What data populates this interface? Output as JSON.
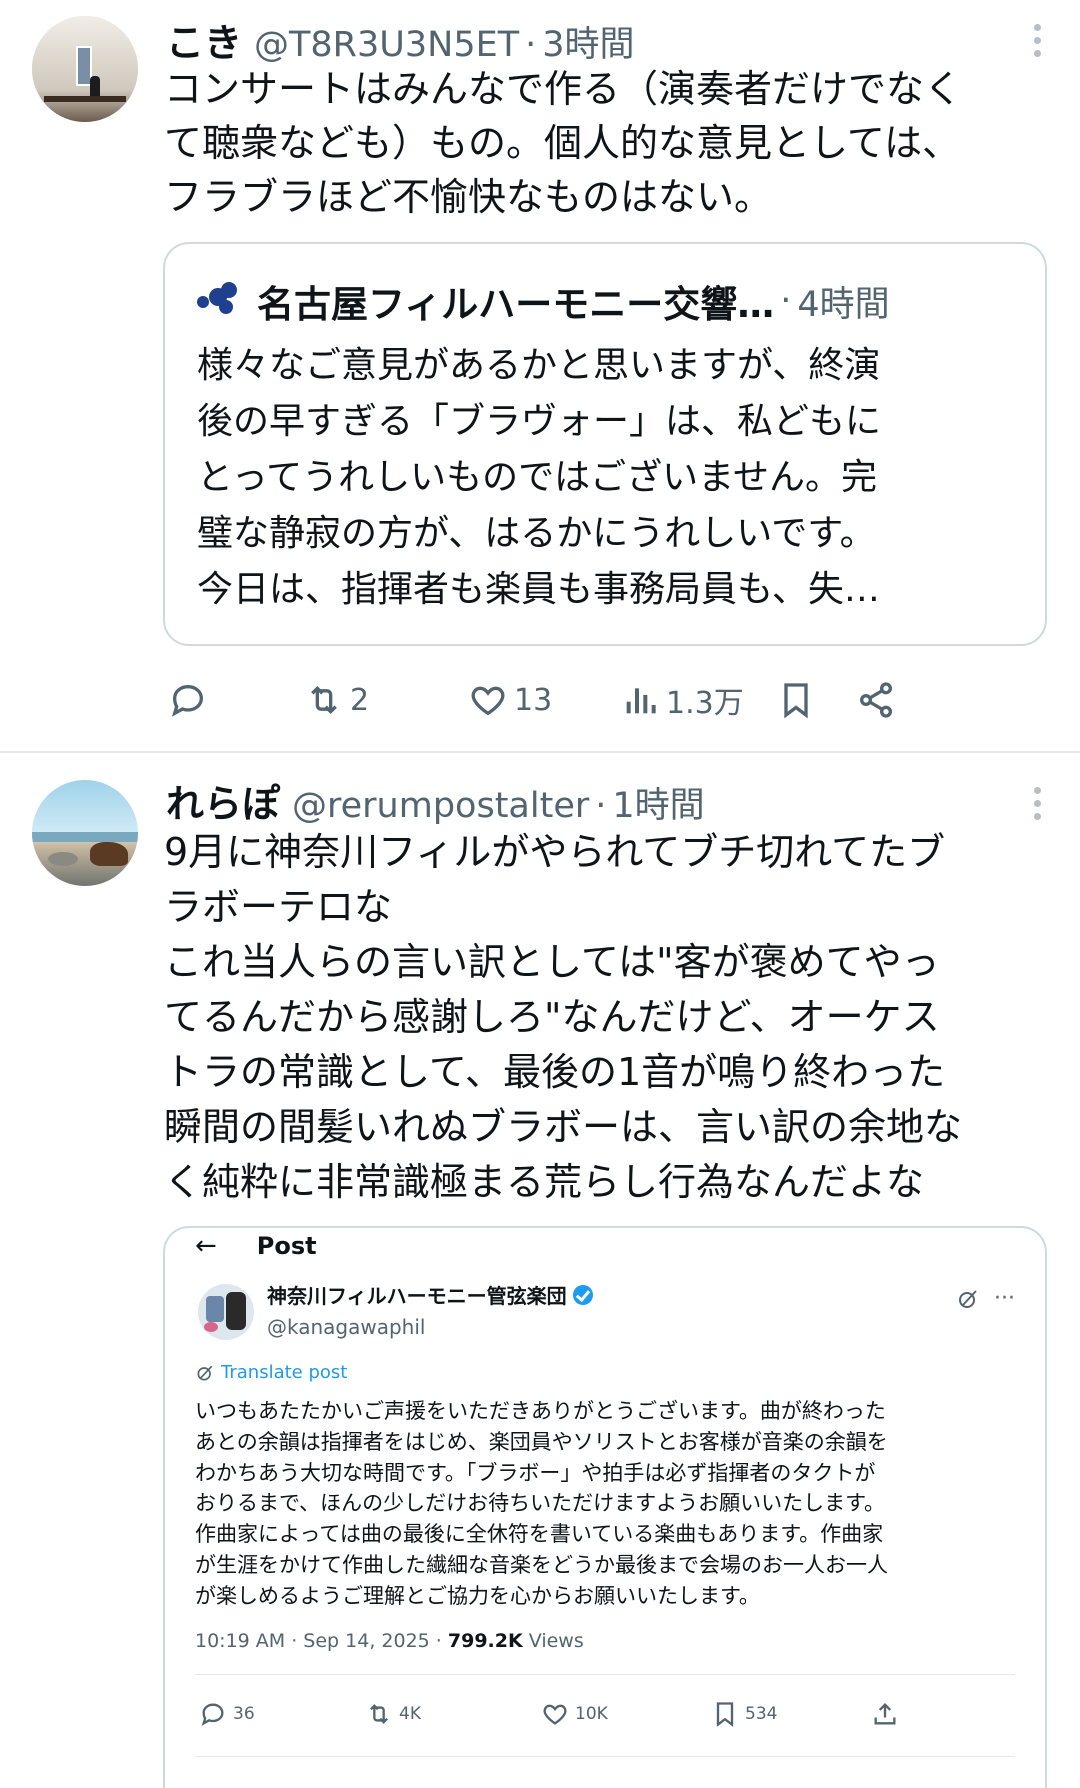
{
  "tweets": [
    {
      "author": {
        "name": "こき",
        "handle": "@T8R3U3N5ET"
      },
      "time": "3時間",
      "text_lines": [
        "コンサートはみんなで作る（演奏者だけでなく",
        "て聴衆なども）もの。個人的な意見としては、",
        "フラブラほど不愉快なものはない。"
      ],
      "quote": {
        "author_name": "名古屋フィルハーモニー交響…",
        "time": "4時間",
        "text_lines": [
          "様々なご意見があるかと思いますが、終演",
          "後の早すぎる「ブラヴォー」は、私どもに",
          "とってうれしいものではございません。完",
          "璧な静寂の方が、はるかにうれしいです。",
          "今日は、指揮者も楽員も事務局員も、失…"
        ]
      },
      "actions": {
        "reply": "",
        "retweet": "2",
        "like": "13",
        "views": "1.3万"
      }
    },
    {
      "author": {
        "name": "れらぽ",
        "handle": "@rerumpostalter"
      },
      "time": "1時間",
      "text_lines": [
        "9月に神奈川フィルがやられてブチ切れてたブ",
        "ラボーテロな",
        "これ当人らの言い訳としては\"客が褒めてやっ",
        "てるんだから感謝しろ\"なんだけど、オーケス",
        "トラの常識として、最後の1音が鳴り終わった",
        "瞬間の間髪いれぬブラボーは、言い訳の余地な",
        "く純粋に非常識極まる荒らし行為なんだよな"
      ],
      "embedded_screenshot": {
        "back": "←",
        "header": "Post",
        "account_name": "神奈川フィルハーモニー管弦楽団",
        "account_handle": "@kanagawaphil",
        "more": "···",
        "translate": "Translate post",
        "text_lines": [
          "いつもあたたかいご声援をいただきありがとうございます。曲が終わった",
          "あとの余韻は指揮者をはじめ、楽団員やソリストとお客様が音楽の余韻を",
          "わかちあう大切な時間です。「ブラボー」や拍手は必ず指揮者のタクトが",
          "おりるまで、ほんの少しだけお待ちいただけますようお願いいたします。",
          "作曲家によっては曲の最後に全休符を書いている楽曲もあります。作曲家",
          "が生涯をかけて作曲した繊細な音楽をどうか最後まで会場のお一人お一人",
          "が楽しめるようご理解とご協力を心からお願いいたします。"
        ],
        "timestamp": "10:19 AM · Sep 14, 2025 · ",
        "views_count": "799.2K",
        "views_label": " Views",
        "actions": {
          "reply": "36",
          "retweet": "4K",
          "like": "10K",
          "bookmark": "534"
        }
      }
    }
  ],
  "colors": {
    "text": "#0f1419",
    "secondary": "#536471",
    "border": "#cfd9de",
    "link": "#1d9bf0"
  }
}
